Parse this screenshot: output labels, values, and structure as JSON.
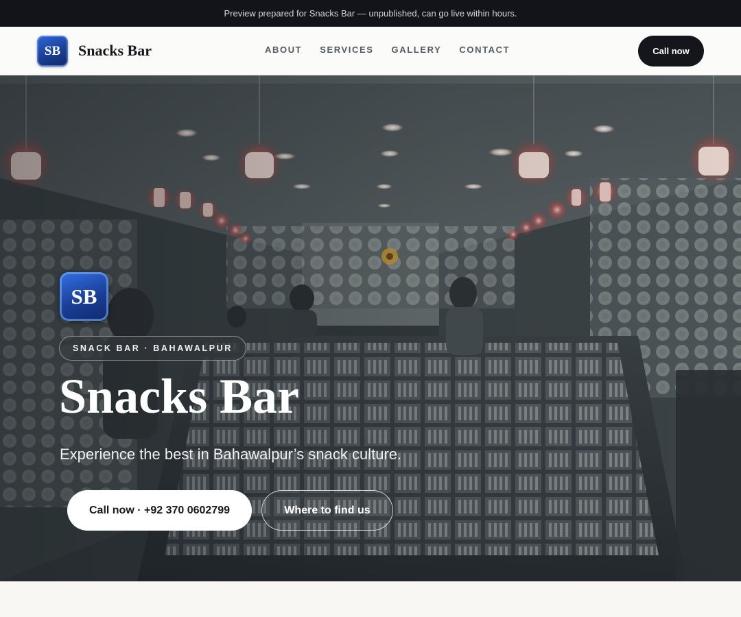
{
  "announcement": "Preview prepared for Snacks Bar — unpublished, can go live within hours.",
  "header": {
    "logo_text": "SB",
    "brand_name": "Snacks Bar",
    "nav": [
      "ABOUT",
      "SERVICES",
      "GALLERY",
      "CONTACT"
    ],
    "cta_label": "Call now"
  },
  "hero": {
    "logo_text": "SB",
    "tag": "SNACK BAR · BAHAWALPUR",
    "title": "Snacks Bar",
    "subtitle": "Experience the best in Bahawalpur’s snack culture.",
    "primary_button": "Call now · +92 370 0602799",
    "secondary_button": "Where to find us"
  },
  "colors": {
    "dark": "#14161b",
    "brand_blue": "#1a3f95",
    "page_bg": "#f8f7f4"
  }
}
